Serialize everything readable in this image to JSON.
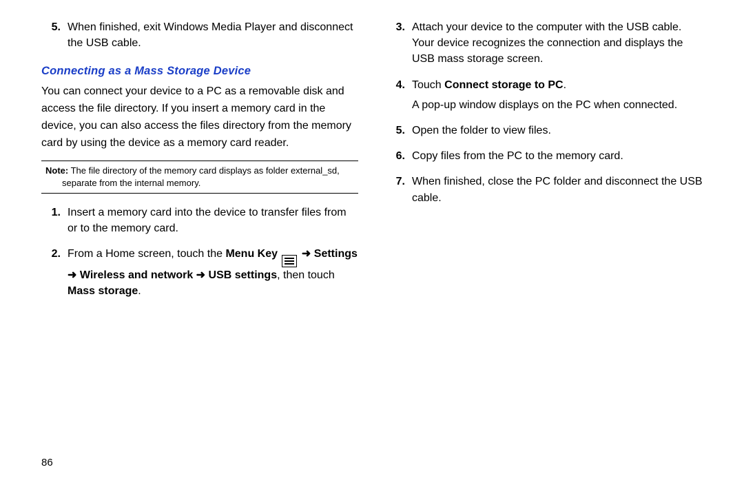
{
  "pageNumber": "86",
  "left": {
    "topItem": {
      "num": "5.",
      "text": "When finished, exit Windows Media Player and disconnect the USB cable."
    },
    "subhead": "Connecting as a Mass Storage Device",
    "intro": "You can connect your device to a PC as a removable disk and access the file directory. If you insert a memory card in the device, you can also access the files directory from the memory card by using the device as a memory card reader.",
    "noteLabel": "Note:",
    "noteText": " The file directory of the memory card displays as folder external_sd, separate from the internal memory.",
    "step1": {
      "num": "1.",
      "text": "Insert a memory card into the device to transfer files from or to the memory card."
    },
    "step2": {
      "num": "2.",
      "pre": "From a Home screen, touch the ",
      "menuKey": "Menu Key",
      "arrow1": " ➜ ",
      "settings": "Settings",
      "arrow2": " ➜ ",
      "wireless": "Wireless and network",
      "arrow3": " ➜ ",
      "usbSettings": "USB settings",
      "thenTouch": ", then touch ",
      "massStorage": "Mass storage",
      "period": "."
    }
  },
  "right": {
    "step3": {
      "num": "3.",
      "text": "Attach your device to the computer with the USB cable. Your device recognizes the connection and displays the USB mass storage screen."
    },
    "step4": {
      "num": "4.",
      "touch": "Touch ",
      "connect": "Connect storage to PC",
      "period": ".",
      "after": "A pop-up window displays on the PC when connected."
    },
    "step5": {
      "num": "5.",
      "text": "Open the folder to view files."
    },
    "step6": {
      "num": "6.",
      "text": "Copy files from the PC to the memory card."
    },
    "step7": {
      "num": "7.",
      "text": "When finished, close the PC folder and disconnect the USB cable."
    }
  }
}
